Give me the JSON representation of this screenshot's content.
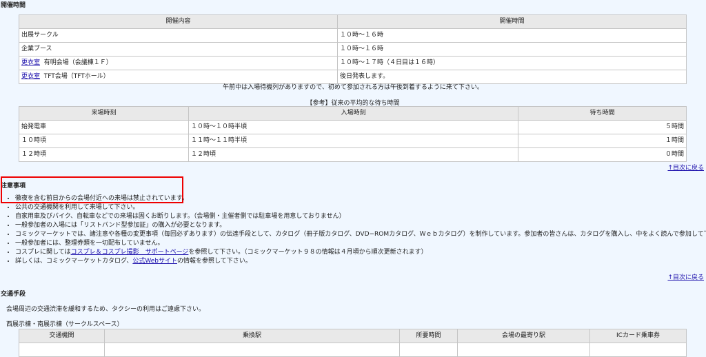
{
  "hours": {
    "heading": "開催時間",
    "columns": [
      "開催内容",
      "開催時間"
    ],
    "rows": [
      {
        "link": "",
        "label": "出展サークル",
        "time": "１０時～１６時"
      },
      {
        "link": "",
        "label": "企業ブース",
        "time": "１０時～１６時"
      },
      {
        "link": "更衣室",
        "label": "有明会場（会議棟１Ｆ）",
        "time": "１０時～１７時（４日目は１６時）"
      },
      {
        "link": "更衣室",
        "label": "TFT会場（TFTホール）",
        "time": "後日発表します。"
      }
    ],
    "note": "午前中は入場待機列がありますので、初めて参加される方は午後到着するように来て下さい。"
  },
  "wait": {
    "caption": "【参考】従来の平均的な待ち時間",
    "columns": [
      "来場時刻",
      "入場時刻",
      "待ち時間"
    ],
    "rows": [
      [
        "始発電車",
        "１０時～１０時半頃",
        "５時間"
      ],
      [
        "１０時頃",
        "１１時～１１時半頃",
        "１時間"
      ],
      [
        "１２時頃",
        "１２時頃",
        "０時間"
      ]
    ]
  },
  "toc_link": "↑目次に戻る",
  "notes": {
    "heading": "注意事項",
    "items": [
      {
        "text": "徹夜を含む前日からの会場付近への来場は禁止されています。"
      },
      {
        "text": "公共の交通機関を利用して来場して下さい。"
      },
      {
        "text": "自家用車及びバイク、自転車などでの来場は固くお断りします。（会場側・主催者側では駐車場を用意しておりません）"
      },
      {
        "text": "一般参加者の入場には「リストバンド型参加証」の購入が必要となります。"
      },
      {
        "text": "コミックマーケットでは、諸注意や各種の変更事項（毎回必ずあります）の伝達手段として、カタログ（冊子版カタログ、DVD−ROMカタログ、Ｗｅｂカタログ）を制作しています。参加者の皆さんは、カタログを購入し、中をよく読んで参加して下さい。"
      },
      {
        "text": "一般参加者には、整理券類を一切配布していません。"
      },
      {
        "pre": "コスプレに関しては",
        "link": "コスプレ＆コスプレ撮影　サポートページ",
        "post": "を参照して下さい。（コミックマーケット９８の情報は４月頃から順次更新されます）"
      },
      {
        "pre": "詳しくは、コミックマーケットカタログ、",
        "link": "公式Webサイト",
        "post": "の情報を参照して下さい。"
      }
    ]
  },
  "transport": {
    "heading": "交通手段",
    "intro": "会場周辺の交通渋滞を緩和するため、タクシーの利用はご遠慮下さい。",
    "subheading": "西展示棟・南展示棟（サークルスペース）",
    "columns": [
      "交通機関",
      "乗換駅",
      "所要時間",
      "会場の最寄り駅",
      "ICカード乗車券"
    ]
  }
}
